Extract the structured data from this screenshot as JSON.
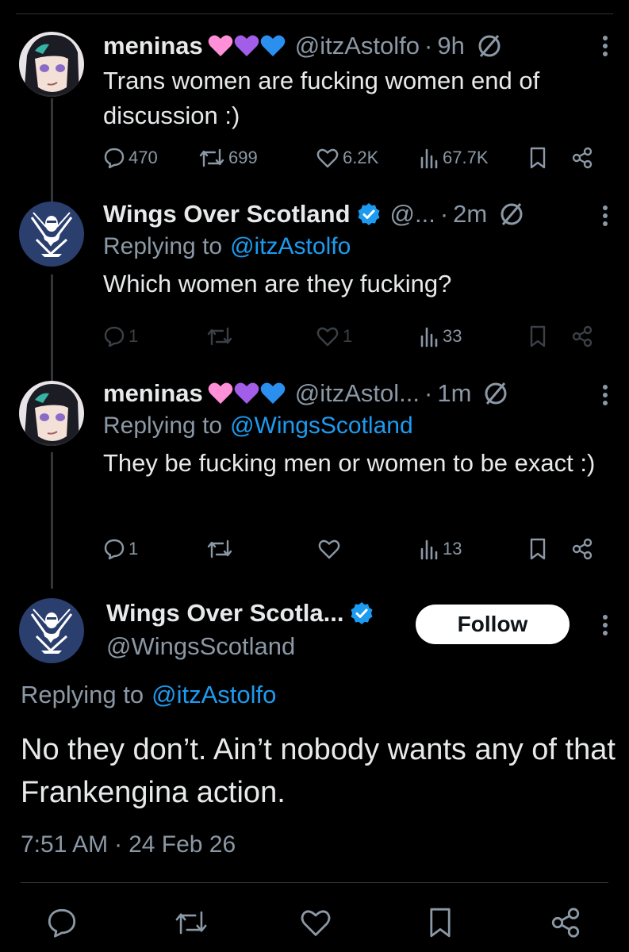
{
  "tweets": [
    {
      "name": "meninas",
      "handle": "@itzAstolfo",
      "dot": "·",
      "time": "9h",
      "reply_prefix": "",
      "reply_to": "",
      "text": "Trans women are fucking women end of discussion :)",
      "replies": "470",
      "retweets": "699",
      "likes": "6.2K",
      "views": "67.7K"
    },
    {
      "name": "Wings Over Scotland",
      "handle": "@...",
      "dot": "·",
      "time": "2m",
      "reply_prefix": "Replying to",
      "reply_to": "@itzAstolfo",
      "text": "Which women are they fucking?",
      "replies": "1",
      "retweets": "",
      "likes": "1",
      "views": "33"
    },
    {
      "name": "meninas",
      "handle": "@itzAstol...",
      "dot": "·",
      "time": "1m",
      "reply_prefix": "Replying to",
      "reply_to": "@WingsScotland",
      "text": "They be fucking men or women to be exact :)",
      "replies": "1",
      "retweets": "",
      "likes": "",
      "views": "13"
    }
  ],
  "main": {
    "name": "Wings Over Scotla...",
    "handle": "@WingsScotland",
    "follow_label": "Follow",
    "reply_prefix": "Replying to",
    "reply_to": "@itzAstolfo",
    "text": "No they don’t. Ain’t nobody wants any of that Frankengina action.",
    "time": "7:51 AM",
    "dot": "·",
    "date": "24 Feb 26"
  },
  "colors": {
    "background": "#000000",
    "text": "#e7e9ea",
    "muted": "#8b98a5",
    "link": "#1d9bf0",
    "verified": "#1d9bf0"
  }
}
